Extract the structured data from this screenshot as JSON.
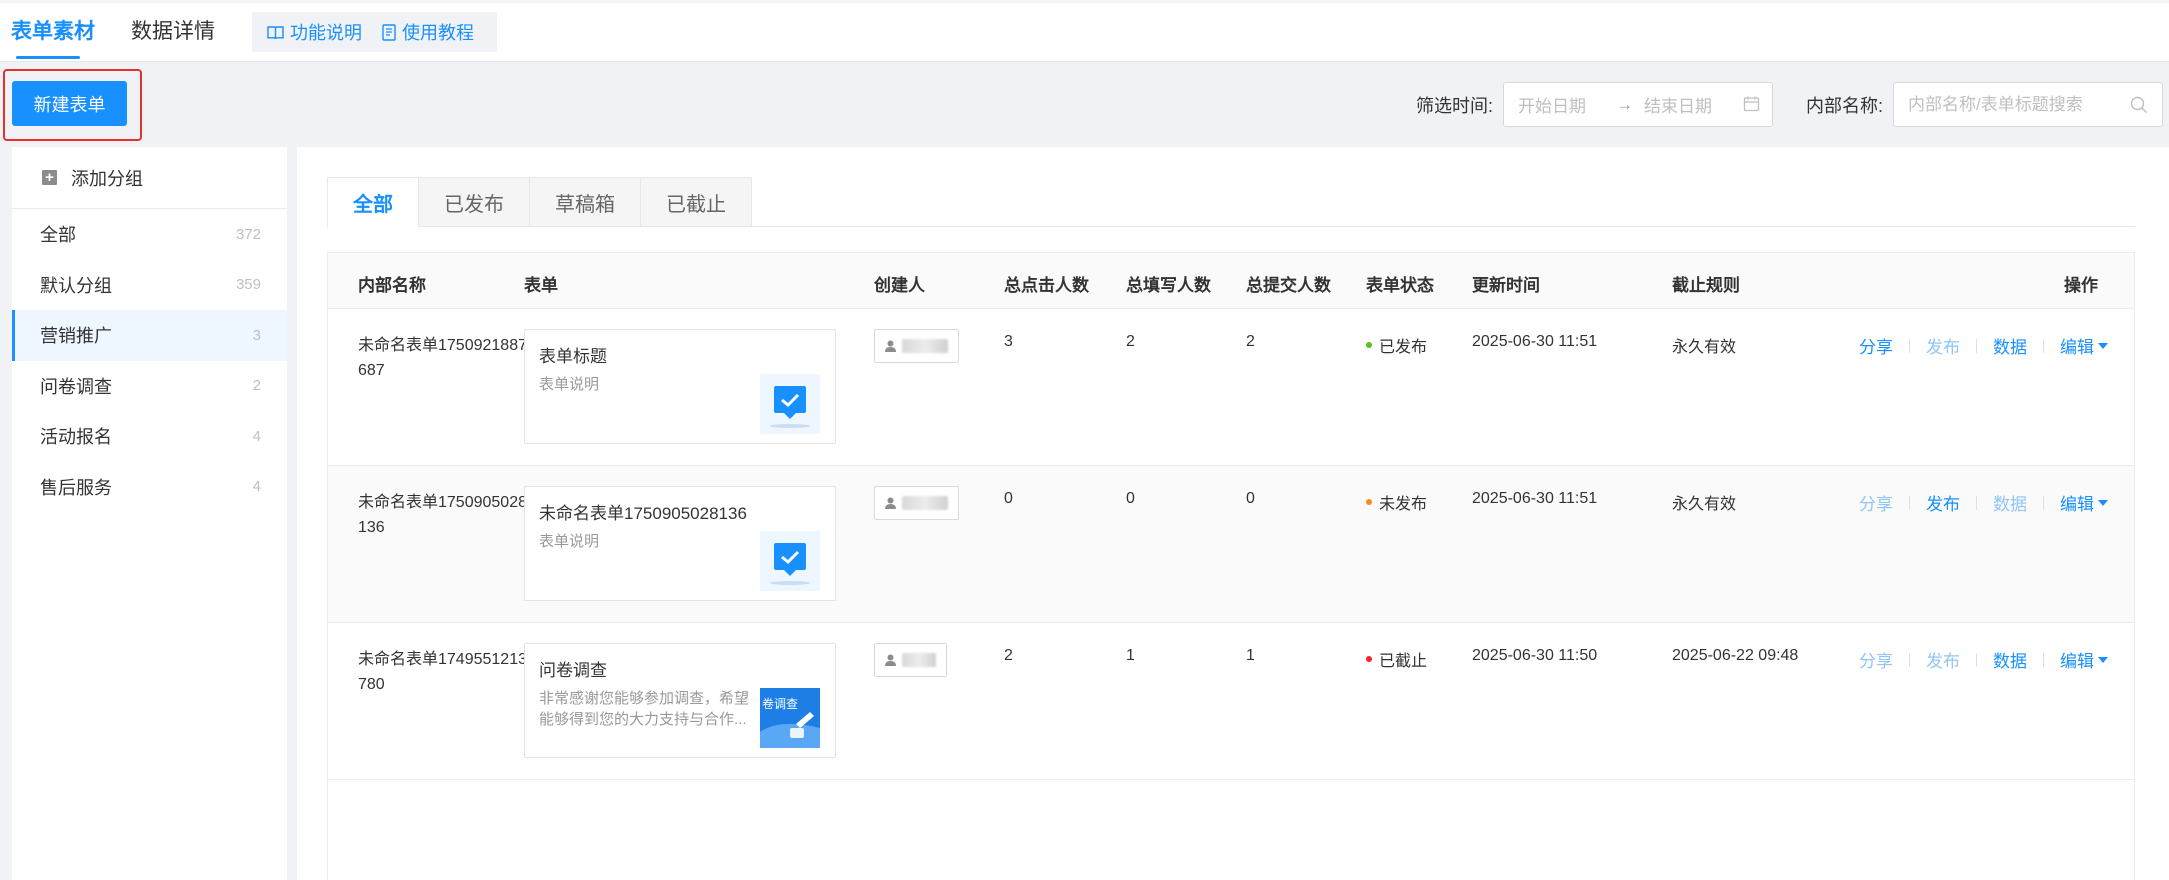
{
  "nav": {
    "tabs": [
      {
        "label": "表单素材",
        "active": true
      },
      {
        "label": "数据详情",
        "active": false
      }
    ],
    "help_links": [
      {
        "label": "功能说明",
        "icon": "book-icon"
      },
      {
        "label": "使用教程",
        "icon": "document-icon"
      }
    ]
  },
  "toolbar": {
    "new_form_label": "新建表单",
    "filter_time_label": "筛选时间:",
    "start_date_placeholder": "开始日期",
    "range_arrow": "→",
    "end_date_placeholder": "结束日期",
    "internal_name_label": "内部名称:",
    "search_placeholder": "内部名称/表单标题搜索"
  },
  "sidebar": {
    "add_group_label": "添加分组",
    "groups": [
      {
        "label": "全部",
        "count": "372"
      },
      {
        "label": "默认分组",
        "count": "359"
      },
      {
        "label": "营销推广",
        "count": "3",
        "active": true
      },
      {
        "label": "问卷调查",
        "count": "2"
      },
      {
        "label": "活动报名",
        "count": "4"
      },
      {
        "label": "售后服务",
        "count": "4"
      }
    ]
  },
  "subtabs": [
    {
      "label": "全部",
      "active": true
    },
    {
      "label": "已发布"
    },
    {
      "label": "草稿箱"
    },
    {
      "label": "已截止"
    }
  ],
  "table": {
    "columns": [
      "内部名称",
      "表单",
      "创建人",
      "总点击人数",
      "总填写人数",
      "总提交人数",
      "表单状态",
      "更新时间",
      "截止规则",
      "操作"
    ],
    "rows": [
      {
        "internal_name": "未命名表单1750921887687",
        "form_title": "表单标题",
        "form_desc": "表单说明",
        "thumb": "chat-check-icon",
        "clicks": "3",
        "fills": "2",
        "submits": "2",
        "status": "已发布",
        "status_color": "#52c41a",
        "updated": "2025-06-30 11:51",
        "rule": "永久有效",
        "ops": {
          "share": "分享",
          "publish": "发布",
          "data": "数据",
          "edit": "编辑"
        },
        "ops_disabled": {
          "share": false,
          "publish": true,
          "data": false
        }
      },
      {
        "internal_name": "未命名表单1750905028136",
        "form_title": "未命名表单1750905028136",
        "form_desc": "表单说明",
        "thumb": "chat-check-icon",
        "clicks": "0",
        "fills": "0",
        "submits": "0",
        "status": "未发布",
        "status_color": "#fa8c16",
        "updated": "2025-06-30 11:51",
        "rule": "永久有效",
        "ops": {
          "share": "分享",
          "publish": "发布",
          "data": "数据",
          "edit": "编辑"
        },
        "ops_disabled": {
          "share": true,
          "publish": false,
          "data": true
        }
      },
      {
        "internal_name": "未命名表单1749551213780",
        "form_title": "问卷调查",
        "form_desc": "非常感谢您能够参加调查，希望能够得到您的大力支持与合作...",
        "thumb": "survey-banner-icon",
        "thumb_text": "卷调查",
        "clicks": "2",
        "fills": "1",
        "submits": "1",
        "status": "已截止",
        "status_color": "#f5222d",
        "updated": "2025-06-30 11:50",
        "rule": "2025-06-22 09:48",
        "ops": {
          "share": "分享",
          "publish": "发布",
          "data": "数据",
          "edit": "编辑"
        },
        "ops_disabled": {
          "share": true,
          "publish": true,
          "data": false
        }
      }
    ]
  },
  "colors": {
    "primary": "#1890ff",
    "highlight_frame": "#e5322d",
    "page_bg": "#f0f2f5"
  }
}
